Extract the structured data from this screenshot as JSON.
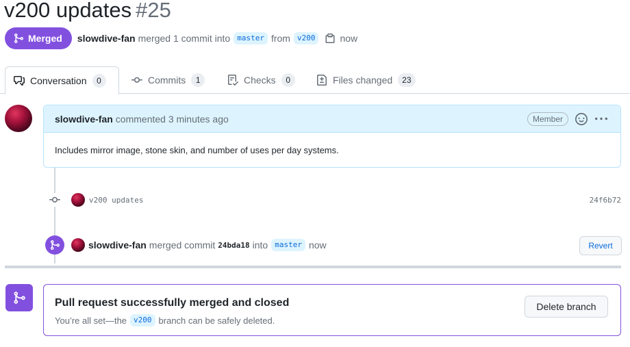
{
  "pr": {
    "title": "v200 updates",
    "number": "#25",
    "state_label": "Merged",
    "author": "slowdive-fan",
    "merged_text": "merged 1 commit into",
    "base_branch": "master",
    "from_text": "from",
    "head_branch": "v200",
    "time": "now"
  },
  "tabs": [
    {
      "label": "Conversation",
      "count": "0",
      "icon": "comment-discussion-icon"
    },
    {
      "label": "Commits",
      "count": "1",
      "icon": "git-commit-icon"
    },
    {
      "label": "Checks",
      "count": "0",
      "icon": "checklist-icon"
    },
    {
      "label": "Files changed",
      "count": "23",
      "icon": "file-diff-icon"
    }
  ],
  "comment": {
    "author": "slowdive-fan",
    "meta": "commented 3 minutes ago",
    "badge": "Member",
    "body": "Includes mirror image, stone skin, and number of uses per day systems."
  },
  "commit": {
    "message": "v200 updates",
    "sha": "24f6b72"
  },
  "merge_event": {
    "author": "slowdive-fan",
    "text": "merged commit",
    "sha": "24bda18",
    "into_text": "into",
    "branch": "master",
    "time": "now",
    "revert_label": "Revert"
  },
  "merge_box": {
    "title": "Pull request successfully merged and closed",
    "sub_before": "You’re all set—the",
    "branch": "v200",
    "sub_after": "branch can be safely deleted.",
    "delete_label": "Delete branch"
  },
  "colors": {
    "merged_purple": "#8250df",
    "link_blue": "#0969da",
    "branch_bg": "#ddf4ff",
    "border": "#d0d7de"
  }
}
